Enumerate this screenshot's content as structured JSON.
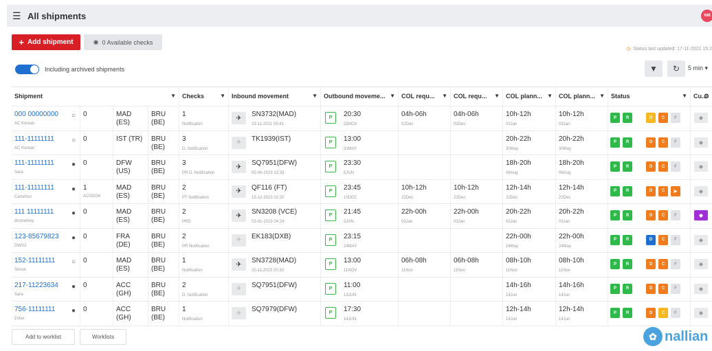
{
  "header": {
    "title": "All shipments",
    "menu_icon": "hamburger-icon",
    "avatar_initials": "NM"
  },
  "toolbar": {
    "add_shipment_label": "Add shipment",
    "available_checks_label": "0 Available checks",
    "last_updated": "Status last updated: 17-11-2021 15:2",
    "archived_toggle_label": "Including archived shipments",
    "refresh_interval": "5 min"
  },
  "colors": {
    "accent_red": "#d81f26",
    "link_blue": "#1f6fd1",
    "green": "#2fb94a",
    "orange": "#f07c1e",
    "yellow": "#f5b820",
    "blue": "#1f6fd1",
    "purple": "#a02fd6"
  },
  "table": {
    "columns": [
      "Shipment",
      "Checks",
      "Inbound movement",
      "Outbound moveme...",
      "COL requ...",
      "COL requ...",
      "COL plann...",
      "COL plann...",
      "Status",
      "Cu..."
    ],
    "rows": [
      {
        "id": "000 00000000",
        "note": "AC Korean",
        "chat": "o",
        "num": "0",
        "num_sub": "",
        "orig": "MAD",
        "orig_cc": "(ES)",
        "dest": "BRU",
        "dest_cc": "(BE)",
        "checks": "1",
        "checks_sub": "Notification",
        "in_flight": "SN3732(MAD)",
        "in_date": "23-11-2021 09:41",
        "in_light": false,
        "out_time": "20:30",
        "out_date": "25NOV",
        "r1": "04h-06h",
        "r1_sub": "02Dec",
        "r2": "04h-06h",
        "r2_sub": "02Dec",
        "p1": "10h-12h",
        "p1_sub": "03Jan",
        "p2": "10h-12h",
        "p2_sub": "03Jan",
        "status": [
          "g",
          "g",
          "",
          "y",
          "o",
          "grey"
        ],
        "tag": "grey"
      },
      {
        "id": "111-11111111",
        "note": "AC Korean",
        "chat": "o",
        "num": "0",
        "num_sub": "",
        "orig": "IST (TR)",
        "orig_cc": "",
        "dest": "BRU",
        "dest_cc": "(BE)",
        "checks": "3",
        "checks_sub": "D. Notification",
        "in_flight": "TK1939(IST)",
        "in_date": "",
        "in_light": true,
        "out_time": "13:00",
        "out_date": "31MAY",
        "r1": "",
        "r1_sub": "",
        "r2": "",
        "r2_sub": "",
        "p1": "20h-22h",
        "p1_sub": "30May",
        "p2": "20h-22h",
        "p2_sub": "30May",
        "status": [
          "g",
          "g",
          "",
          "o",
          "o",
          "grey"
        ],
        "tag": "grey"
      },
      {
        "id": "111-11111111",
        "note": "Sara",
        "chat": "f",
        "num": "0",
        "num_sub": "",
        "orig": "DFW",
        "orig_cc": "(US)",
        "dest": "BRU",
        "dest_cc": "(BE)",
        "checks": "3",
        "checks_sub": "PR D. Notification",
        "in_flight": "SQ7951(DFW)",
        "in_date": "05-06-2023 12:33",
        "in_light": false,
        "out_time": "23:30",
        "out_date": "5JUN",
        "r1": "",
        "r1_sub": "",
        "r2": "",
        "r2_sub": "",
        "p1": "18h-20h",
        "p1_sub": "06Aug",
        "p2": "18h-20h",
        "p2_sub": "06Aug",
        "status": [
          "g",
          "g",
          "",
          "o",
          "o",
          "grey"
        ],
        "tag": "grey"
      },
      {
        "id": "111-11111111",
        "note": "Carrefour",
        "chat": "f",
        "num": "1",
        "num_sub": "AC03234",
        "orig": "MAD",
        "orig_cc": "(ES)",
        "dest": "BRU",
        "dest_cc": "(BE)",
        "checks": "2",
        "checks_sub": "PT Notification",
        "in_flight": "QF116 (FT)",
        "in_date": "15-12-2023 02:20",
        "in_light": false,
        "out_time": "23:45",
        "out_date": "15DEC",
        "r1": "10h-12h",
        "r1_sub": "22Dec",
        "r2": "10h-12h",
        "r2_sub": "22Dec",
        "p1": "12h-14h",
        "p1_sub": "22Dec",
        "p2": "12h-14h",
        "p2_sub": "22Dec",
        "status": [
          "g",
          "g",
          "",
          "o",
          "o",
          "o"
        ],
        "tag": "grey"
      },
      {
        "id": "111 11111111",
        "note": "drumerkey",
        "chat": "f",
        "num": "0",
        "num_sub": "",
        "orig": "MAD",
        "orig_cc": "(ES)",
        "dest": "BRU",
        "dest_cc": "(BE)",
        "checks": "2",
        "checks_sub": "PRD",
        "in_flight": "SN3208 (VCE)",
        "in_date": "03-01-2023 04:24",
        "in_light": false,
        "out_time": "21:45",
        "out_date": "3JAN",
        "r1": "22h-00h",
        "r1_sub": "03Jan",
        "r2": "22h-00h",
        "r2_sub": "03Jan",
        "p1": "20h-22h",
        "p1_sub": "03Jan",
        "p2": "20h-22h",
        "p2_sub": "03Jan",
        "status": [
          "g",
          "g",
          "",
          "o",
          "o",
          "grey"
        ],
        "tag": "purple"
      },
      {
        "id": "123-85679823",
        "note": "DWS2",
        "chat": "f",
        "num": "0",
        "num_sub": "",
        "orig": "FRA",
        "orig_cc": "(DE)",
        "dest": "BRU",
        "dest_cc": "(BE)",
        "checks": "2",
        "checks_sub": "PR Notification",
        "in_flight": "EK183(DXB)",
        "in_date": "",
        "in_light": true,
        "out_time": "23:15",
        "out_date": "24MAY",
        "r1": "",
        "r1_sub": "",
        "r2": "",
        "r2_sub": "",
        "p1": "22h-00h",
        "p1_sub": "24May",
        "p2": "22h-00h",
        "p2_sub": "24May",
        "status": [
          "g",
          "g",
          "",
          "b",
          "o",
          "grey"
        ],
        "tag": "grey"
      },
      {
        "id": "152-11111111",
        "note": "Simon",
        "chat": "o",
        "num": "0",
        "num_sub": "",
        "orig": "MAD",
        "orig_cc": "(ES)",
        "dest": "BRU",
        "dest_cc": "(BE)",
        "checks": "1",
        "checks_sub": "Notification",
        "in_flight": "SN3728(MAD)",
        "in_date": "20-11-2023 20:30",
        "in_light": false,
        "out_time": "13:00",
        "out_date": "11NOV",
        "r1": "06h-08h",
        "r1_sub": "11Nov",
        "r2": "06h-08h",
        "r2_sub": "11Nov",
        "p1": "08h-10h",
        "p1_sub": "11Nov",
        "p2": "08h-10h",
        "p2_sub": "11Nov",
        "status": [
          "g",
          "g",
          "",
          "o",
          "o",
          "grey"
        ],
        "tag": "grey"
      },
      {
        "id": "217-11223634",
        "note": "Sara",
        "chat": "f",
        "num": "0",
        "num_sub": "",
        "orig": "ACC",
        "orig_cc": "(GH)",
        "dest": "BRU",
        "dest_cc": "(BE)",
        "checks": "2",
        "checks_sub": "D. Notification",
        "in_flight": "SQ7951(DFW)",
        "in_date": "",
        "in_light": true,
        "out_time": "11:00",
        "out_date": "13JUN",
        "r1": "",
        "r1_sub": "",
        "r2": "",
        "r2_sub": "",
        "p1": "14h-16h",
        "p1_sub": "14Jun",
        "p2": "14h-16h",
        "p2_sub": "14Jun",
        "status": [
          "g",
          "g",
          "",
          "o",
          "o",
          "grey"
        ],
        "tag": "grey"
      },
      {
        "id": "756-11111111",
        "note": "Zolax",
        "chat": "f",
        "num": "0",
        "num_sub": "",
        "orig": "ACC",
        "orig_cc": "(GH)",
        "dest": "BRU",
        "dest_cc": "(BE)",
        "checks": "1",
        "checks_sub": "Notification",
        "in_flight": "SQ7979(DFW)",
        "in_date": "",
        "in_light": true,
        "out_time": "17:30",
        "out_date": "14JUN",
        "r1": "",
        "r1_sub": "",
        "r2": "",
        "r2_sub": "",
        "p1": "12h-14h",
        "p1_sub": "14Jun",
        "p2": "12h-14h",
        "p2_sub": "14Jun",
        "status": [
          "g",
          "g",
          "",
          "o",
          "y",
          "grey"
        ],
        "tag": "grey"
      }
    ]
  },
  "footer": {
    "add_to_worklist_label": "Add to worklist",
    "worklists_label": "Worklists",
    "brand": "nallian"
  }
}
